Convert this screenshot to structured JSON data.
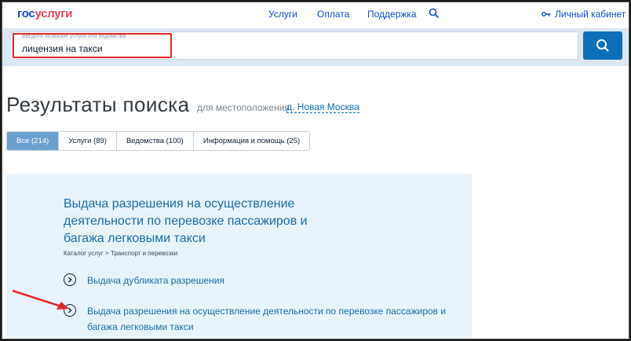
{
  "header": {
    "logo_part1": "гос",
    "logo_part2": "услуги",
    "nav": [
      "Услуги",
      "Оплата",
      "Поддержка"
    ],
    "search_icon": "search-icon",
    "cabinet_icon": "key-icon",
    "cabinet_label": "Личный кабинет"
  },
  "search": {
    "hint": "Введите название услуги или ведомства",
    "value": "лицензия на такси",
    "button_icon": "search-icon"
  },
  "results": {
    "title": "Результаты поиска",
    "for_location": "для местоположения",
    "location_prefix": "д.",
    "location_name": "Новая Москва",
    "tabs": [
      {
        "label": "Все (214)",
        "active": true
      },
      {
        "label": "Услуги (89)",
        "active": false
      },
      {
        "label": "Ведомства (100)",
        "active": false
      },
      {
        "label": "Информация и помощь (25)",
        "active": false
      }
    ]
  },
  "card": {
    "title": "Выдача разрешения на осуществление деятельности по перевозке пассажиров и багажа легковыми такси",
    "breadcrumb": "Каталог услуг > Транспорт и перевозки",
    "links": [
      "Выдача дубликата разрешения",
      "Выдача разрешения на осуществление деятельности по перевозке пассажиров и багажа легковыми такси"
    ],
    "link_icon": "chevron-right-circle-icon"
  },
  "colors": {
    "brand_blue": "#0d4cd3",
    "brand_red": "#ee3f58",
    "search_button": "#0d6fb8",
    "active_tab": "#6a9fce",
    "card_bg": "#e8f3fb",
    "annotation_red": "#e3262b"
  }
}
